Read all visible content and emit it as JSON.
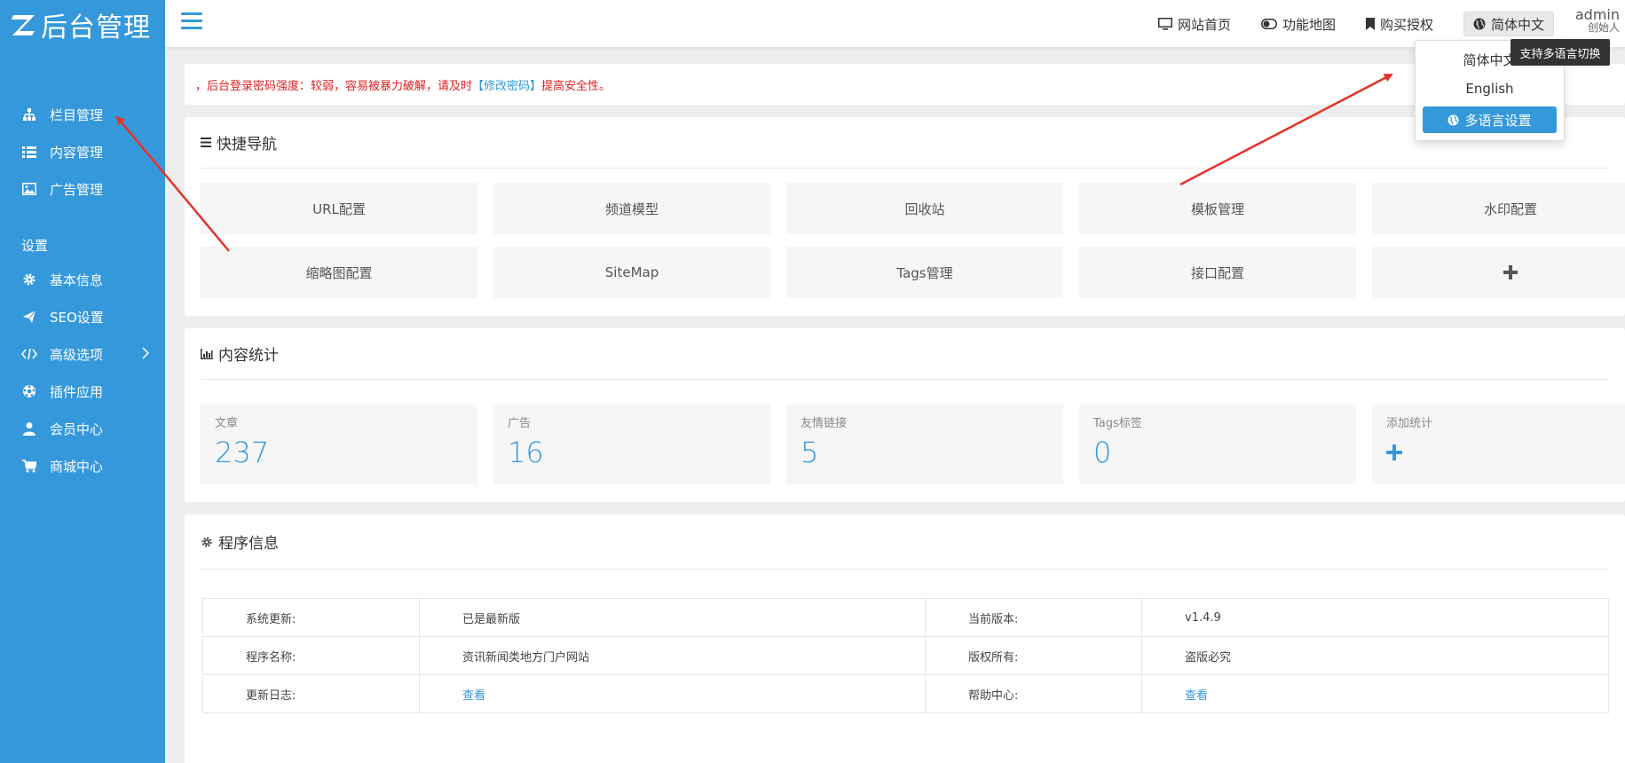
{
  "sidebar": {
    "logo_text": "后台管理",
    "items": [
      {
        "label": "栏目管理",
        "icon": "sitemap-icon"
      },
      {
        "label": "内容管理",
        "icon": "list-icon"
      },
      {
        "label": "广告管理",
        "icon": "image-icon"
      }
    ],
    "section_label": "设置",
    "settings": [
      {
        "label": "基本信息",
        "icon": "gear-icon"
      },
      {
        "label": "SEO设置",
        "icon": "paper-plane-icon"
      },
      {
        "label": "高级选项",
        "icon": "code-icon"
      },
      {
        "label": "插件应用",
        "icon": "puzzle-icon"
      },
      {
        "label": "会员中心",
        "icon": "user-icon"
      },
      {
        "label": "商城中心",
        "icon": "cart-icon"
      }
    ]
  },
  "topbar": {
    "links": [
      "网站首页",
      "功能地图",
      "购买授权"
    ],
    "language": "简体中文",
    "user_name": "admin",
    "user_role": "创始人"
  },
  "dropdown": {
    "items": [
      "简体中文",
      "English"
    ],
    "settings_button": "多语言设置",
    "tooltip": "支持多语言切换"
  },
  "alert": {
    "prefix": "，后台登录密码强度：较弱，容易被暴力破解，请及时",
    "link": "【修改密码】",
    "suffix": "提高安全性。"
  },
  "quick_nav": {
    "title": "快捷导航",
    "items": [
      "URL配置",
      "频道模型",
      "回收站",
      "模板管理",
      "水印配置",
      "缩略图配置",
      "SiteMap",
      "Tags管理",
      "接口配置"
    ]
  },
  "stats": {
    "title": "内容统计",
    "items": [
      {
        "label": "文章",
        "value": "237"
      },
      {
        "label": "广告",
        "value": "16"
      },
      {
        "label": "友情链接",
        "value": "5"
      },
      {
        "label": "Tags标签",
        "value": "0"
      }
    ],
    "add_label": "添加统计"
  },
  "program_info": {
    "title": "程序信息",
    "rows": [
      {
        "l1": "系统更新:",
        "v1": "已是最新版",
        "l2": "当前版本:",
        "v2": "v1.4.9"
      },
      {
        "l1": "程序名称:",
        "v1": "资讯新闻类地方门户网站",
        "l2": "版权所有:",
        "v2": "盗版必究"
      },
      {
        "l1": "更新日志:",
        "v1": "查看",
        "l2": "帮助中心:",
        "v2": "查看"
      }
    ]
  },
  "colors": {
    "accent": "#3598db",
    "alert": "#e02020",
    "annotation": "#e8322b"
  }
}
